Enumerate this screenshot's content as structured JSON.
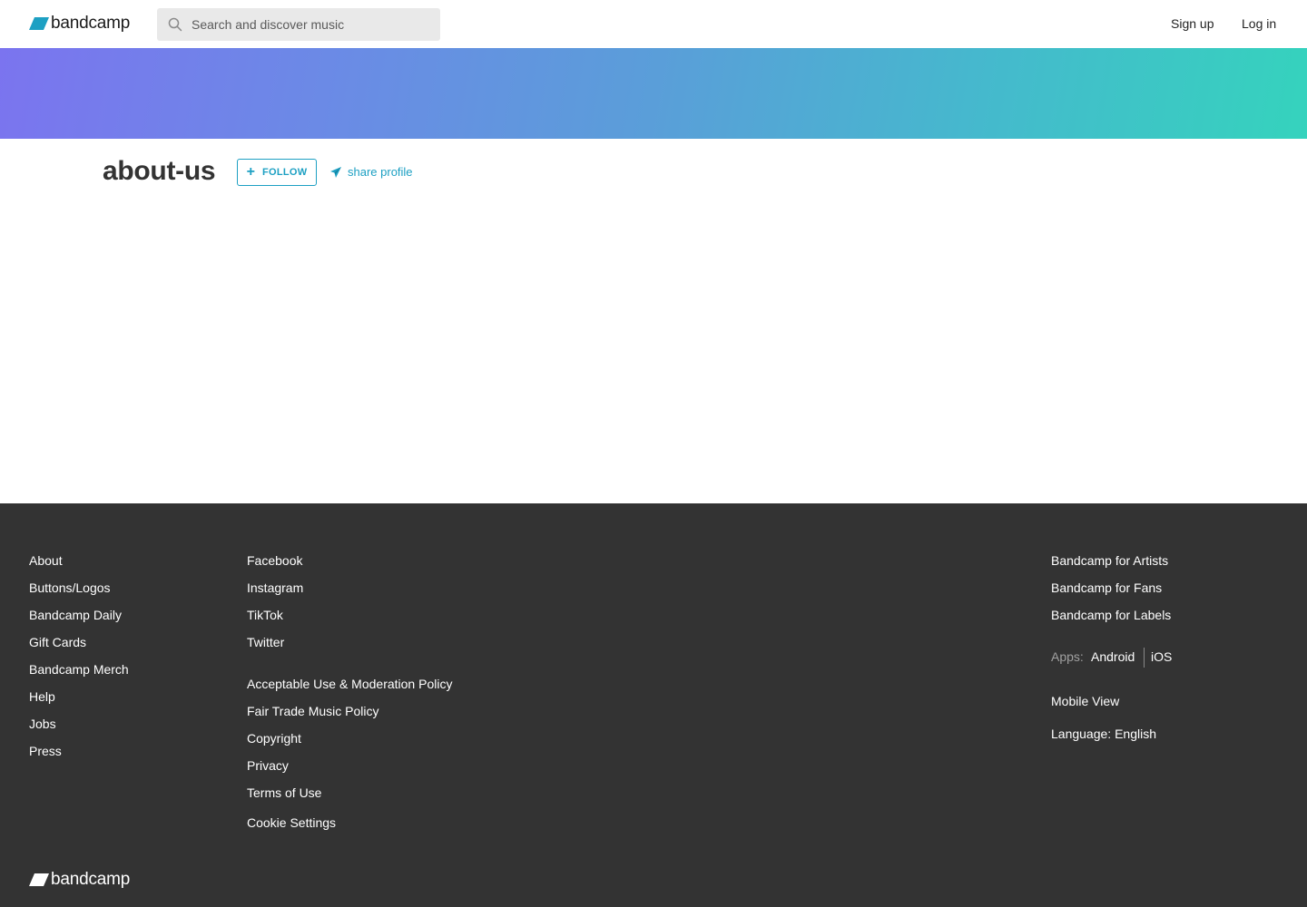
{
  "header": {
    "brand": "bandcamp",
    "search_placeholder": "Search and discover music",
    "signup_label": "Sign up",
    "login_label": "Log in",
    "brand_color": "#1da0c3"
  },
  "banner": {
    "gradient_colors": [
      "#7b74ef",
      "#5a9ed9",
      "#35d3bd"
    ]
  },
  "profile": {
    "name": "about-us",
    "follow_label": "FOLLOW",
    "share_label": "share profile",
    "icons": [
      "plus-icon",
      "paper-plane-icon"
    ]
  },
  "footer": {
    "col1": [
      "About",
      "Buttons/Logos",
      "Bandcamp Daily",
      "Gift Cards",
      "Bandcamp Merch",
      "Help",
      "Jobs",
      "Press"
    ],
    "col2_social": [
      "Facebook",
      "Instagram",
      "TikTok",
      "Twitter"
    ],
    "col2_policy": [
      "Acceptable Use & Moderation Policy",
      "Fair Trade Music Policy",
      "Copyright",
      "Privacy",
      "Terms of Use"
    ],
    "cookie_settings": "Cookie Settings",
    "col3": [
      "Bandcamp for Artists",
      "Bandcamp for Fans",
      "Bandcamp for Labels"
    ],
    "apps_label": "Apps:",
    "apps": [
      "Android",
      "iOS"
    ],
    "mobile_view": "Mobile View",
    "language": "Language: English",
    "brand": "bandcamp"
  }
}
